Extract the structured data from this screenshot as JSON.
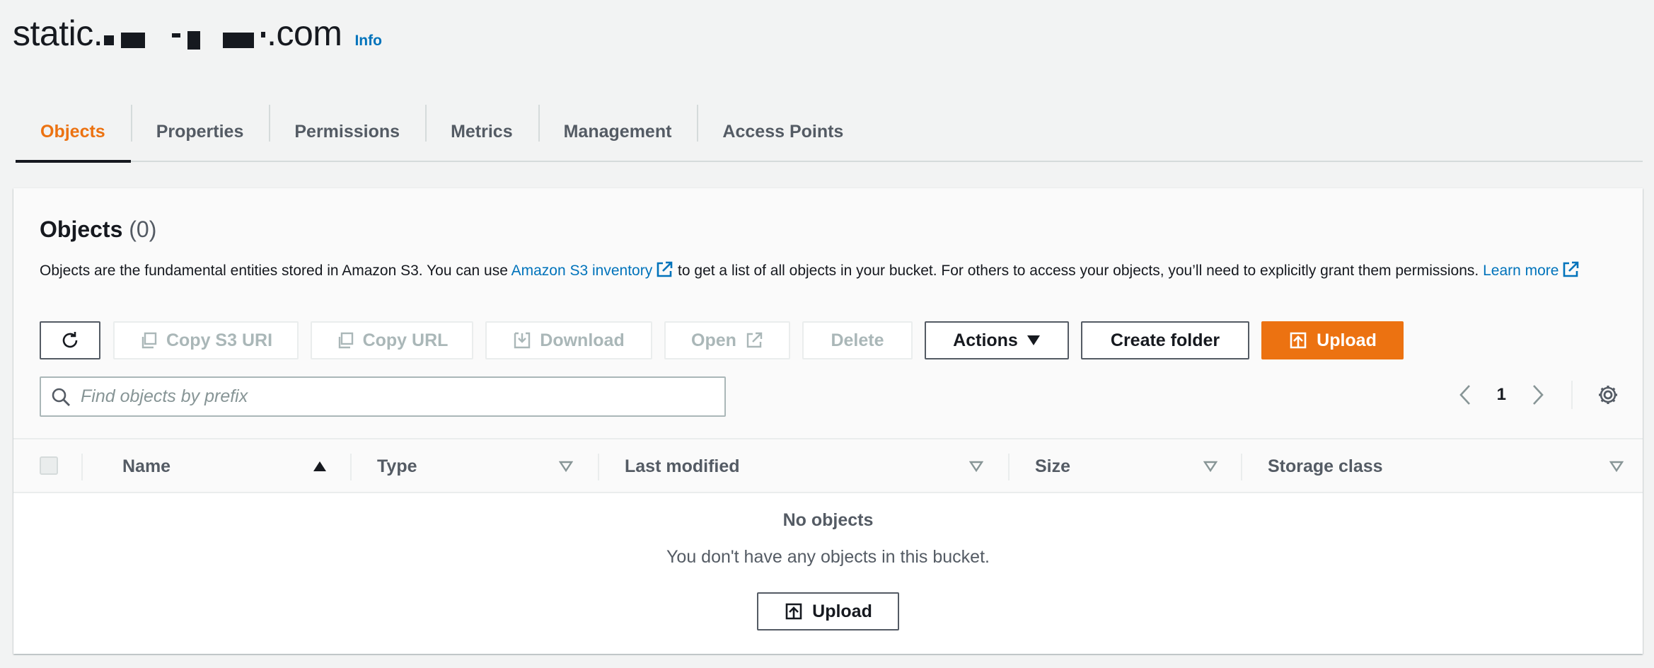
{
  "header": {
    "bucket_prefix": "static.",
    "bucket_suffix": ".com",
    "info_label": "Info"
  },
  "tabs": [
    {
      "label": "Objects",
      "active": true
    },
    {
      "label": "Properties"
    },
    {
      "label": "Permissions"
    },
    {
      "label": "Metrics"
    },
    {
      "label": "Management"
    },
    {
      "label": "Access Points"
    }
  ],
  "objects_panel": {
    "title": "Objects",
    "count": "(0)",
    "desc_part1": "Objects are the fundamental entities stored in Amazon S3. You can use ",
    "inventory_link": "Amazon S3 inventory",
    "desc_part2": " to get a list of all objects in your bucket. For others to access your objects, you’ll need to explicitly grant them permissions. ",
    "learn_more_link": "Learn more"
  },
  "toolbar": {
    "refresh_icon": "refresh-icon",
    "copy_s3_uri": "Copy S3 URI",
    "copy_url": "Copy URL",
    "download": "Download",
    "open": "Open",
    "delete": "Delete",
    "actions": "Actions",
    "create_folder": "Create folder",
    "upload": "Upload"
  },
  "search": {
    "placeholder": "Find objects by prefix",
    "value": ""
  },
  "pagination": {
    "current_page": "1"
  },
  "table": {
    "columns": [
      "Name",
      "Type",
      "Last modified",
      "Size",
      "Storage class"
    ]
  },
  "empty_state": {
    "title": "No objects",
    "description": "You don't have any objects in this bucket.",
    "button": "Upload"
  },
  "colors": {
    "accent": "#ec7211",
    "link": "#0073bb",
    "text": "#16191f",
    "muted": "#545b64",
    "disabled": "#aab7b8"
  }
}
